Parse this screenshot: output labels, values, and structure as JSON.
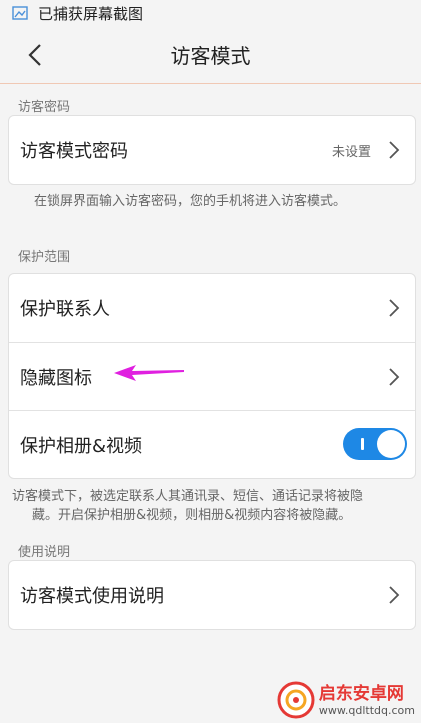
{
  "status_bar": {
    "text": "已捕获屏幕截图",
    "icon": "screenshot-icon"
  },
  "header": {
    "title": "访客模式",
    "back_icon": "back-arrow-icon"
  },
  "sections": {
    "password": {
      "label": "访客密码",
      "row": {
        "label": "访客模式密码",
        "value": "未设置"
      },
      "note": "在锁屏界面输入访客密码，您的手机将进入访客模式。"
    },
    "protection": {
      "label": "保护范围",
      "rows": [
        {
          "label": "保护联系人"
        },
        {
          "label": "隐藏图标"
        },
        {
          "label": "保护相册&视频",
          "toggle_on": true
        }
      ],
      "note_line1": "访客模式下，被选定联系人其通讯录、短信、通话记录将被隐",
      "note_line2": "藏。开启保护相册&视频，则相册&视频内容将被隐藏。"
    },
    "usage": {
      "label": "使用说明",
      "row": {
        "label": "访客模式使用说明"
      }
    }
  },
  "colors": {
    "accent": "#1e88e5",
    "annotation_arrow": "#e020e0",
    "watermark": "#e53935"
  },
  "watermark": {
    "name": "启东安卓网",
    "url": "www.qdlttdq.com"
  }
}
